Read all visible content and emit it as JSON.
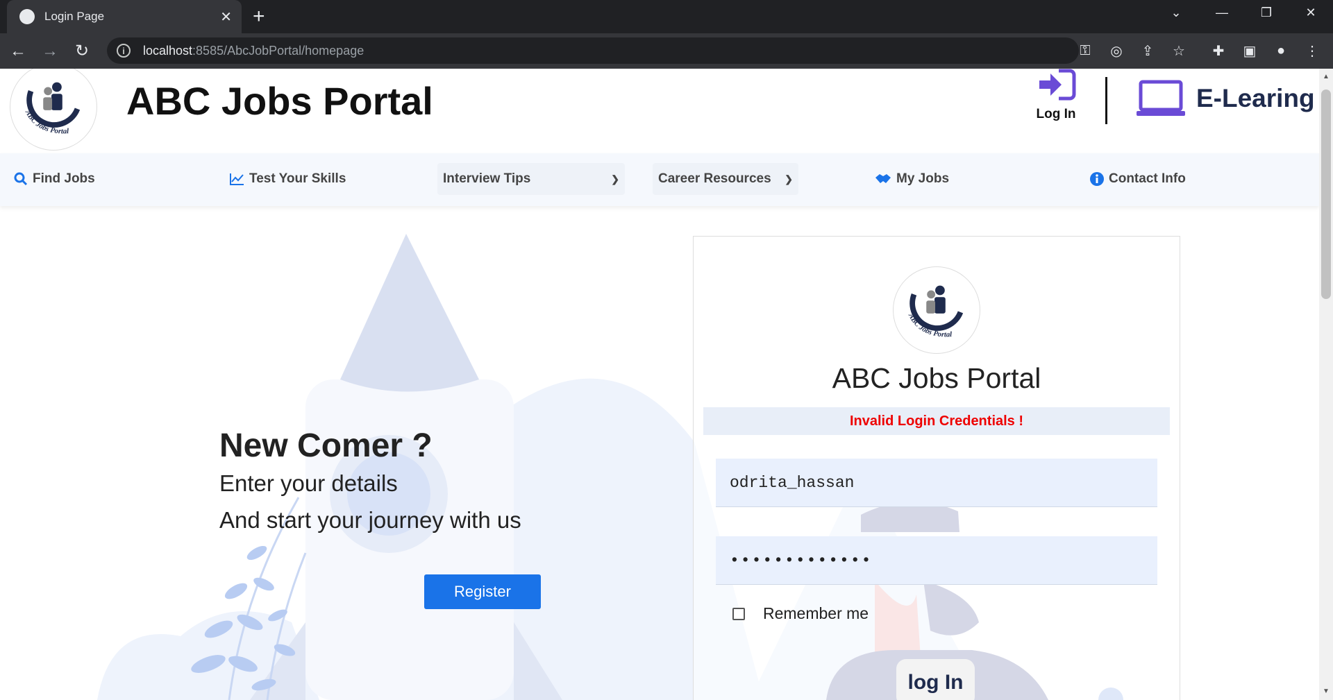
{
  "browser": {
    "tab_title": "Login Page",
    "new_tab": "+",
    "url_host": "localhost",
    "url_path": ":8585/AbcJobPortal/homepage"
  },
  "header": {
    "site_title": "ABC Jobs Portal",
    "login_label": "Log In",
    "elearning_label": "E-Learing",
    "logo_text": "ABC Jobs Portal"
  },
  "nav": {
    "find_jobs": "Find Jobs",
    "test_skills": "Test Your Skills",
    "interview_tips": "Interview Tips",
    "career_resources": "Career Resources",
    "my_jobs": "My Jobs",
    "contact_info": "Contact Info"
  },
  "hero": {
    "heading": "New Comer ?",
    "line1": "Enter your details",
    "line2": "And start your journey with us",
    "register_label": "Register"
  },
  "login_card": {
    "title": "ABC Jobs Portal",
    "error": "Invalid Login Credentials !",
    "username_value": "odrita_hassan",
    "password_mask": "•••••••••••••",
    "remember_label": "Remember me",
    "submit_label": "log In"
  },
  "colors": {
    "accent": "#1a73e8",
    "error": "#ee0000",
    "login_icon": "#6a4bd6",
    "navy": "#1f2b4d"
  }
}
